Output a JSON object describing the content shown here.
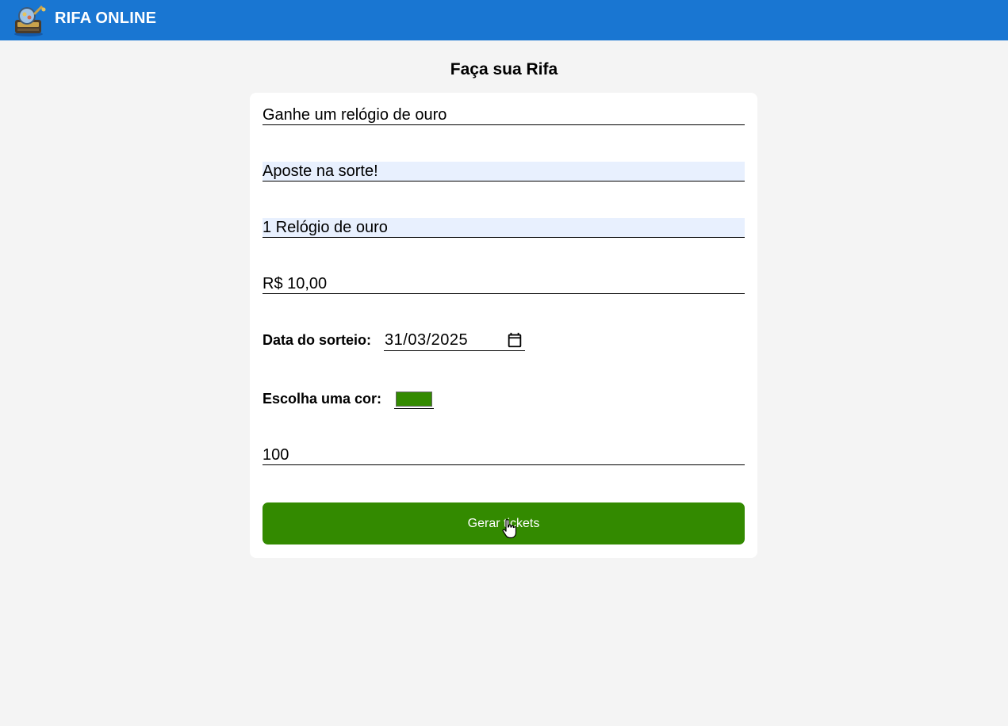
{
  "app": {
    "brand": "RIFA ONLINE",
    "header_color": "#1976d2"
  },
  "page": {
    "title": "Faça sua Rifa"
  },
  "form": {
    "title_value": "Ganhe um relógio de ouro",
    "description_value": "Aposte na sorte!",
    "prize_value": "1 Relógio de ouro",
    "price_value": "R$ 10,00",
    "date_label": "Data do sorteio:",
    "date_value": "31/03/2025",
    "color_label": "Escolha uma cor:",
    "color_value": "#338a00",
    "quantity_value": "100",
    "submit_label": "Gerar tickets",
    "submit_color": "#338a00",
    "autofill_color": "#e8f0fe"
  },
  "icons": {
    "logo": "raffle-machine-logo",
    "calendar": "calendar-icon",
    "cursor": "hand-pointer-cursor"
  }
}
